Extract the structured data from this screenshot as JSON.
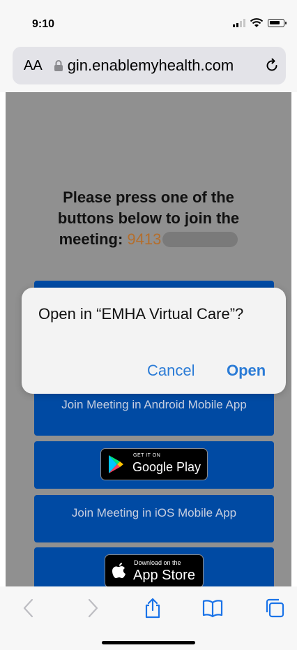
{
  "status_bar": {
    "time": "9:10"
  },
  "browser": {
    "text_size_label": "AA",
    "url": "gin.enablemyhealth.com"
  },
  "page": {
    "heading_line1": "Please press one of the",
    "heading_line2": "buttons below to join the",
    "heading_line3": "meeting:",
    "meeting_id_visible": "9413",
    "android_join_label": "Join Meeting in Android Mobile App",
    "google_play_small": "GET IT ON",
    "google_play_large": "Google Play",
    "ios_join_label": "Join Meeting in iOS Mobile App",
    "app_store_small": "Download on the",
    "app_store_large": "App Store"
  },
  "dialog": {
    "title": "Open in “EMHA Virtual Care”?",
    "cancel_label": "Cancel",
    "open_label": "Open"
  },
  "toolbar": {
    "back_icon": "chevron-left",
    "forward_icon": "chevron-right",
    "share_icon": "share",
    "bookmarks_icon": "book",
    "tabs_icon": "tabs"
  }
}
